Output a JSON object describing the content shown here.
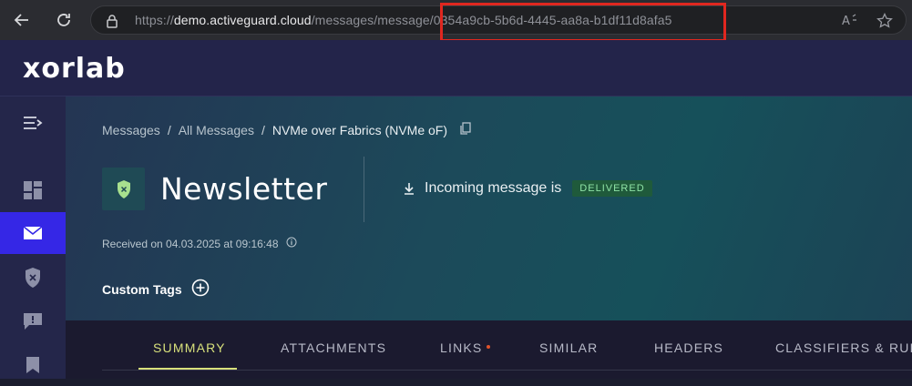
{
  "browser": {
    "url_host": "demo.activeguard.cloud",
    "url_scheme": "https://",
    "url_path": "/messages/message/",
    "url_id": "0354a9cb-5b6d-4445-aa8a-b1df11d8afa5"
  },
  "app": {
    "logo": "xorlab"
  },
  "sidebar": {
    "items": [
      {
        "icon": "menu-expand-icon"
      },
      {
        "icon": "dashboard-icon"
      },
      {
        "icon": "mail-icon",
        "active": true
      },
      {
        "icon": "shield-x-icon"
      },
      {
        "icon": "alert-message-icon"
      },
      {
        "icon": "bookmark-icon"
      }
    ]
  },
  "breadcrumb": {
    "items": [
      "Messages",
      "All Messages",
      "NVMe over Fabrics (NVMe oF)"
    ],
    "separator": "/"
  },
  "message": {
    "title": "Newsletter",
    "status_text": "Incoming message is",
    "status_badge": "DELIVERED",
    "received": "Received on 04.03.2025 at 09:16:48",
    "custom_tags_label": "Custom Tags"
  },
  "tabs": {
    "items": [
      "SUMMARY",
      "ATTACHMENTS",
      "LINKS",
      "SIMILAR",
      "HEADERS",
      "CLASSIFIERS & RULES"
    ],
    "active": "SUMMARY"
  },
  "colors": {
    "accent": "#3527e6",
    "tab_active": "#d7e07b",
    "badge_bg": "#1f5a3b",
    "badge_text": "#8fe3a6",
    "highlight": "#e0271f"
  }
}
